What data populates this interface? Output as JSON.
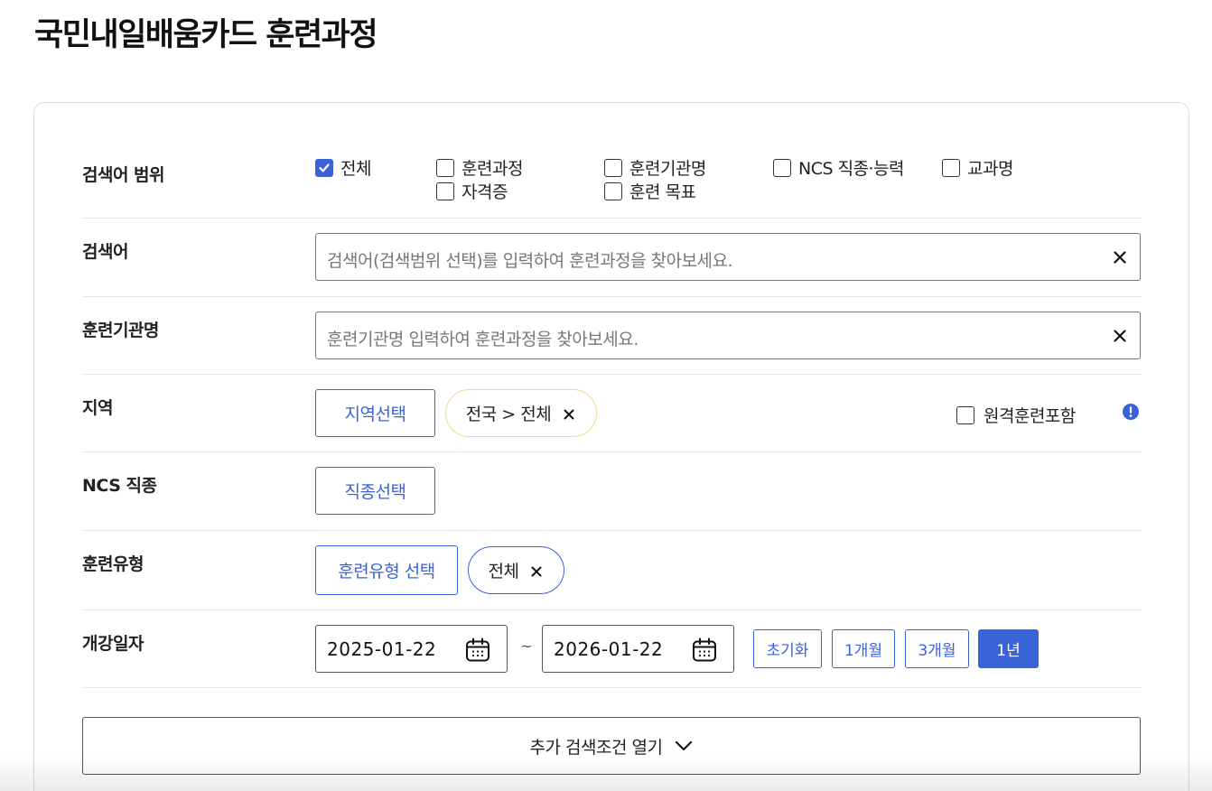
{
  "page": {
    "title": "국민내일배움카드 훈련과정"
  },
  "scope": {
    "label": "검색어 범위",
    "options": [
      {
        "label": "전체",
        "checked": true
      },
      {
        "label": "훈련과정",
        "checked": false
      },
      {
        "label": "훈련기관명",
        "checked": false
      },
      {
        "label": "NCS 직종·능력",
        "checked": false
      },
      {
        "label": "교과명",
        "checked": false
      },
      {
        "label": "자격증",
        "checked": false
      },
      {
        "label": "훈련 목표",
        "checked": false
      }
    ]
  },
  "keyword": {
    "label": "검색어",
    "placeholder": "검색어(검색범위 선택)를 입력하여 훈련과정을 찾아보세요.",
    "value": ""
  },
  "institution": {
    "label": "훈련기관명",
    "placeholder": "훈련기관명 입력하여 훈련과정을 찾아보세요.",
    "value": ""
  },
  "region": {
    "label": "지역",
    "select_label": "지역선택",
    "chip": "전국 > 전체",
    "remote_label": "원격훈련포함",
    "remote_checked": false
  },
  "ncs": {
    "label": "NCS 직종",
    "select_label": "직종선택"
  },
  "training_type": {
    "label": "훈련유형",
    "select_label": "훈련유형 선택",
    "chip": "전체"
  },
  "date_range": {
    "label": "개강일자",
    "start": "2025-01-22",
    "separator": "~",
    "end": "2026-01-22",
    "presets": [
      "초기화",
      "1개월",
      "3개월",
      "1년"
    ],
    "active_preset": "1년"
  },
  "more": {
    "label": "추가 검색조건 열기"
  },
  "colors": {
    "accent": "#3a63d8",
    "chip_border_yellow": "#f1d98a",
    "chip_border_blue": "#3a63d8",
    "info_icon": "#3a63d8"
  },
  "icons": {
    "clear": "close-icon",
    "calendar": "calendar-icon",
    "info": "info-icon",
    "expand": "chevron-down-icon"
  }
}
